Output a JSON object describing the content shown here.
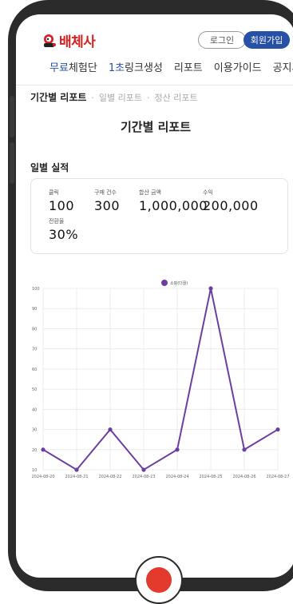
{
  "header": {
    "logo": "배체사",
    "login": "로그인",
    "signup": "회원가입"
  },
  "menu": {
    "items": [
      "무료체험단",
      "1초링크생성",
      "리포트",
      "이용가이드",
      "공지사"
    ]
  },
  "breadcrumb": {
    "current": "기간별 리포트",
    "sep": "·",
    "daily": "일별 리포트",
    "settlement": "정산 리포트"
  },
  "page": {
    "title": "기간별 리포트",
    "section": "일별 실적"
  },
  "stats": {
    "clicks_label": "클릭",
    "clicks": "100",
    "purchases_label": "구매 건수",
    "purchases": "300",
    "amount_label": "합산 금액",
    "amount": "1,000,000",
    "revenue_label": "수익",
    "revenue": "200,000",
    "conversion_label": "전환율",
    "conversion": "30%"
  },
  "chart_data": {
    "type": "line",
    "x": [
      "2024-08-20",
      "2024-08-21",
      "2024-08-22",
      "2024-08-23",
      "2024-08-24",
      "2024-08-25",
      "2024-08-26",
      "2024-08-27"
    ],
    "series": [
      {
        "name": "쇼핑(더끌)",
        "values": [
          20,
          10,
          30,
          10,
          20,
          100,
          20,
          30
        ]
      }
    ],
    "ylim": [
      10,
      100
    ],
    "yticks": [
      10,
      20,
      30,
      40,
      50,
      60,
      70,
      80,
      90,
      100
    ],
    "grid": true,
    "legend": "top-center",
    "color": "#6b3fa0"
  }
}
